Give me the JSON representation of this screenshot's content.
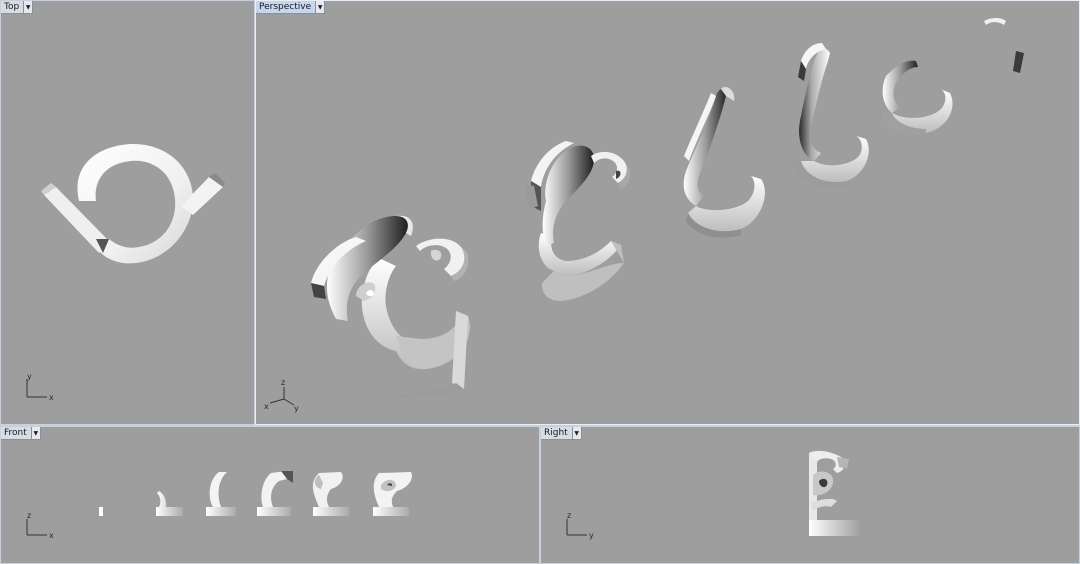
{
  "viewports": {
    "top": {
      "label": "Top",
      "axis_x": "x",
      "axis_y": "y"
    },
    "perspective": {
      "label": "Perspective",
      "axis_x": "x",
      "axis_y": "y",
      "axis_z": "z"
    },
    "front": {
      "label": "Front",
      "axis_x": "x",
      "axis_y": "z"
    },
    "right": {
      "label": "Right",
      "axis_x": "y",
      "axis_y": "z"
    }
  },
  "dropdown_icon": "chevron-down-icon",
  "colors": {
    "viewport_bg": "#9e9e9e",
    "active_tab": "#c6d6ee",
    "tab": "#d8dce4"
  }
}
